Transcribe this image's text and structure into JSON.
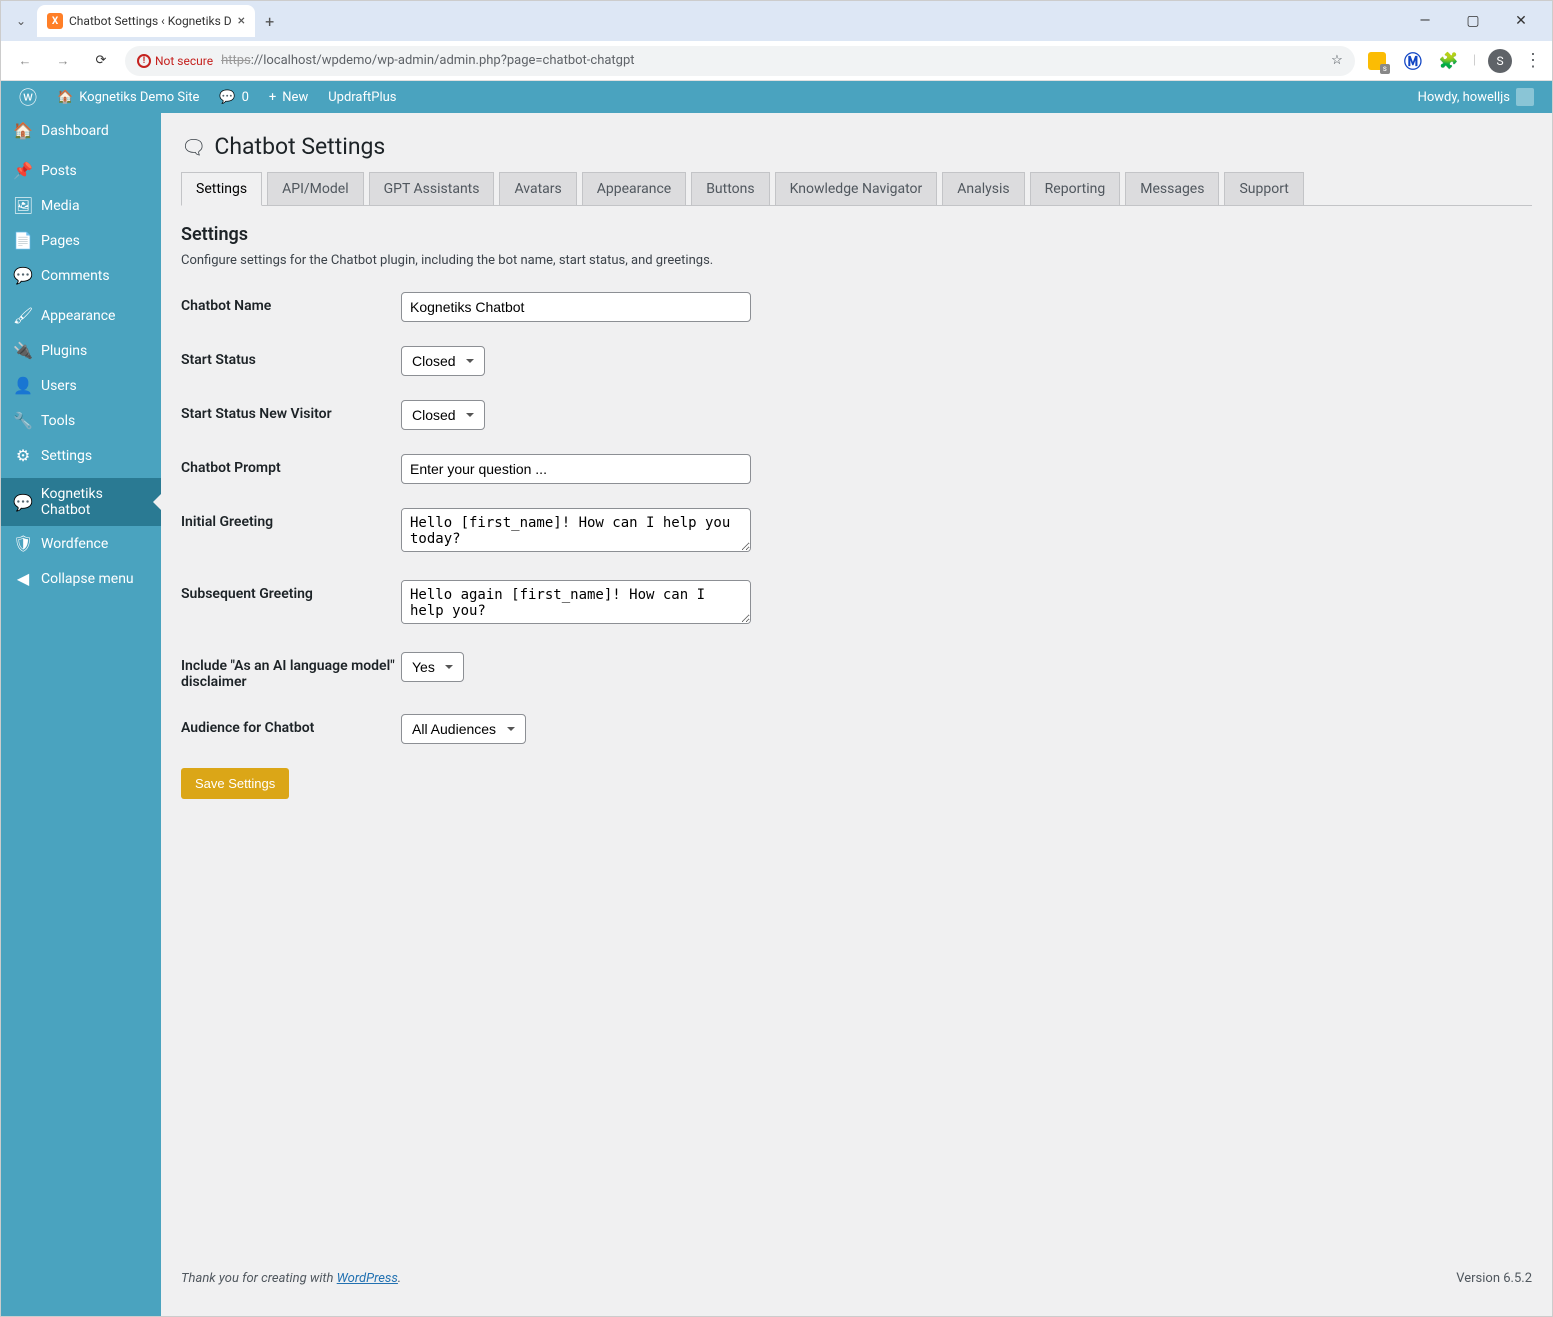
{
  "browser": {
    "tab_title": "Chatbot Settings ‹ Kognetiks D",
    "not_secure": "Not secure",
    "url_protocol": "https",
    "url_rest": "://localhost/wpdemo/wp-admin/admin.php?page=chatbot-chatgpt",
    "profile_initial": "S"
  },
  "adminbar": {
    "site_name": "Kognetiks Demo Site",
    "comments": "0",
    "new": "New",
    "updraft": "UpdraftPlus",
    "howdy": "Howdy, howelljs"
  },
  "sidebar": {
    "items": [
      {
        "icon": "🏠",
        "label": "Dashboard"
      },
      {
        "icon": "📌",
        "label": "Posts"
      },
      {
        "icon": "🖼",
        "label": "Media"
      },
      {
        "icon": "📄",
        "label": "Pages"
      },
      {
        "icon": "💬",
        "label": "Comments"
      },
      {
        "icon": "🖌",
        "label": "Appearance"
      },
      {
        "icon": "🔌",
        "label": "Plugins"
      },
      {
        "icon": "👤",
        "label": "Users"
      },
      {
        "icon": "🔧",
        "label": "Tools"
      },
      {
        "icon": "⚙",
        "label": "Settings"
      },
      {
        "icon": "💬",
        "label": "Kognetiks Chatbot"
      },
      {
        "icon": "🛡",
        "label": "Wordfence"
      },
      {
        "icon": "◀",
        "label": "Collapse menu"
      }
    ]
  },
  "page": {
    "title": "Chatbot Settings",
    "tabs": [
      "Settings",
      "API/Model",
      "GPT Assistants",
      "Avatars",
      "Appearance",
      "Buttons",
      "Knowledge Navigator",
      "Analysis",
      "Reporting",
      "Messages",
      "Support"
    ],
    "section_title": "Settings",
    "section_desc": "Configure settings for the Chatbot plugin, including the bot name, start status, and greetings.",
    "fields": {
      "chatbot_name": {
        "label": "Chatbot Name",
        "value": "Kognetiks Chatbot"
      },
      "start_status": {
        "label": "Start Status",
        "value": "Closed"
      },
      "start_status_new": {
        "label": "Start Status New Visitor",
        "value": "Closed"
      },
      "prompt": {
        "label": "Chatbot Prompt",
        "value": "Enter your question ..."
      },
      "initial_greeting": {
        "label": "Initial Greeting",
        "value": "Hello [first_name]! How can I help you today?"
      },
      "subsequent_greeting": {
        "label": "Subsequent Greeting",
        "value": "Hello again [first_name]! How can I help you?"
      },
      "disclaimer": {
        "label": "Include \"As an AI language model\" disclaimer",
        "value": "Yes"
      },
      "audience": {
        "label": "Audience for Chatbot",
        "value": "All Audiences"
      }
    },
    "save_button": "Save Settings"
  },
  "footer": {
    "thanks_prefix": "Thank you for creating with ",
    "thanks_link": "WordPress",
    "version": "Version 6.5.2"
  }
}
